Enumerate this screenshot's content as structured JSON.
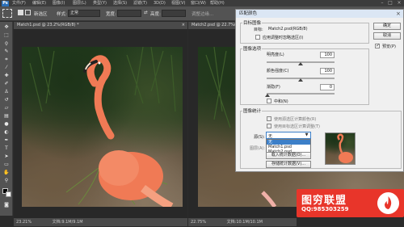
{
  "app": {
    "logo": "Ps",
    "menus": [
      "文件(F)",
      "编辑(E)",
      "图像(I)",
      "图层(L)",
      "类型(Y)",
      "选择(S)",
      "滤镜(T)",
      "3D(D)",
      "视图(V)",
      "窗口(W)",
      "帮助(H)"
    ]
  },
  "options_bar": {
    "new_selection_label": "新选区",
    "style_label": "样式:",
    "style_value": "正常",
    "width_label": "宽度:",
    "height_label": "高度:",
    "refine_edge": "调整边缘..."
  },
  "documents": [
    {
      "tab": "Match1.psd @ 23.2%(RGB/8) *",
      "zoom": "23.21%",
      "doc_info": "文档:9.1M/9.1M"
    },
    {
      "tab": "Match2.psd @ 22.7%(RGB/8) *",
      "zoom": "22.75%",
      "doc_info": "文档:10.1M/10.1M"
    }
  ],
  "dialog": {
    "title": "匹配颜色",
    "target_group": "目标图像",
    "target_label": "目标:",
    "target_value": "Match2.psd(RGB/8)",
    "ignore_selection": "应用调整时忽略选区(I)",
    "image_options_group": "图像选项",
    "luminance_label": "明亮度(L)",
    "luminance_value": "100",
    "color_intensity_label": "颜色强度(C)",
    "color_intensity_value": "100",
    "fade_label": "渐隐(F)",
    "fade_value": "0",
    "neutralize": "中和(N)",
    "stats_group": "图像统计",
    "use_source_selection": "使用源选区计算颜色(R)",
    "use_target_selection": "使用目标选区计算调整(T)",
    "source_label": "源(S):",
    "source_selected": "无",
    "source_options": [
      "无",
      "Match1.psd",
      "Match2.psd"
    ],
    "layer_label": "图层(A):",
    "load_stats": "载入统计数据(O)...",
    "save_stats": "存储统计数据(V)...",
    "ok": "确定",
    "cancel": "取消",
    "preview": "预览(P)"
  },
  "watermark": {
    "title": "图穷联盟",
    "qq": "QQ:985303259"
  },
  "colors": {
    "accent": "#e8352a",
    "flamingo": "#f07a55"
  }
}
